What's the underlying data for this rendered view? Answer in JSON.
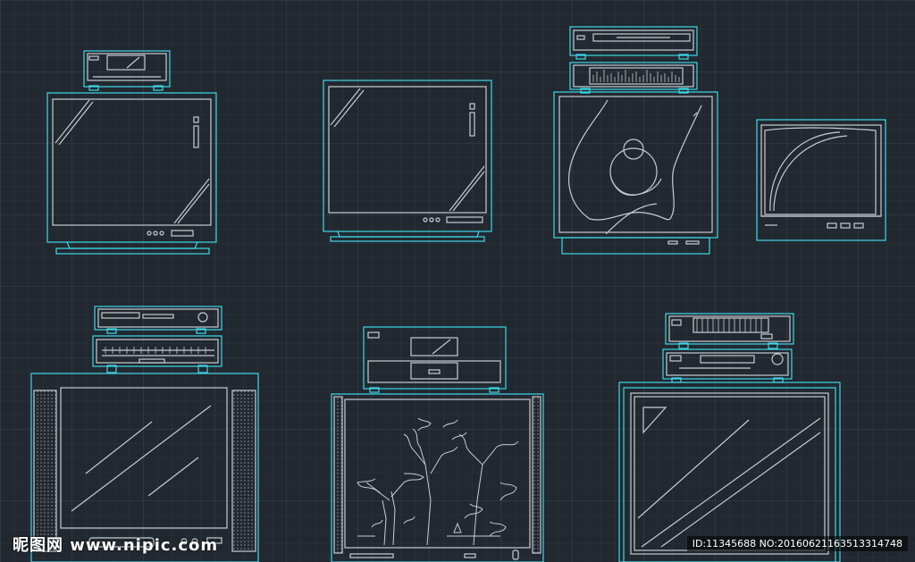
{
  "colors": {
    "background": "#212830",
    "grid_minor": "#2c343d",
    "grid_major": "#3a434d",
    "outline_cyan": "#3fd8e8",
    "detail_gray": "#c8cdd2"
  },
  "watermark": {
    "site": "昵图网 www.nipic.com",
    "id_text": "ID:11345688 NO:20160621163513314748"
  }
}
